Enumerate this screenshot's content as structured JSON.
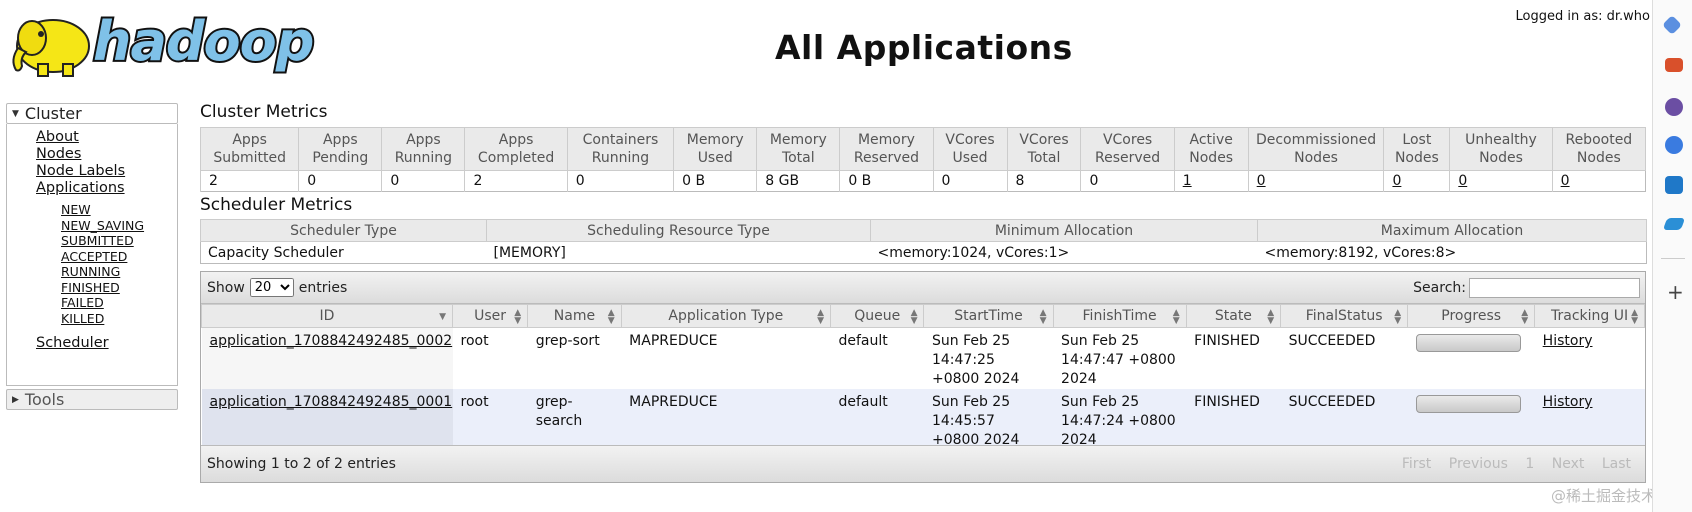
{
  "header": {
    "logo_text": "hadoop",
    "login_text": "Logged in as: dr.who",
    "page_title": "All Applications"
  },
  "sidebar": {
    "cluster_label": "Cluster",
    "links": [
      "About",
      "Nodes",
      "Node Labels",
      "Applications"
    ],
    "app_states": [
      "NEW",
      "NEW_SAVING",
      "SUBMITTED",
      "ACCEPTED",
      "RUNNING",
      "FINISHED",
      "FAILED",
      "KILLED"
    ],
    "scheduler_label": "Scheduler",
    "tools_label": "Tools"
  },
  "cluster_metrics": {
    "title": "Cluster Metrics",
    "headers": [
      "Apps Submitted",
      "Apps Pending",
      "Apps Running",
      "Apps Completed",
      "Containers Running",
      "Memory Used",
      "Memory Total",
      "Memory Reserved",
      "VCores Used",
      "VCores Total",
      "VCores Reserved",
      "Active Nodes",
      "Decommissioned Nodes",
      "Lost Nodes",
      "Unhealthy Nodes",
      "Rebooted Nodes"
    ],
    "values": [
      "2",
      "0",
      "0",
      "2",
      "0",
      "0 B",
      "8 GB",
      "0 B",
      "0",
      "8",
      "0",
      "1",
      "0",
      "0",
      "0",
      "0"
    ]
  },
  "scheduler_metrics": {
    "title": "Scheduler Metrics",
    "headers": [
      "Scheduler Type",
      "Scheduling Resource Type",
      "Minimum Allocation",
      "Maximum Allocation"
    ],
    "values": [
      "Capacity Scheduler",
      "[MEMORY]",
      "<memory:1024, vCores:1>",
      "<memory:8192, vCores:8>"
    ]
  },
  "apps_table": {
    "show_label": "Show",
    "entries_label": "entries",
    "page_size": "20",
    "search_label": "Search:",
    "search_value": "",
    "headers": [
      "ID",
      "User",
      "Name",
      "Application Type",
      "Queue",
      "StartTime",
      "FinishTime",
      "State",
      "FinalStatus",
      "Progress",
      "Tracking UI"
    ],
    "rows": [
      {
        "id": "application_1708842492485_0002",
        "user": "root",
        "name": "grep-sort",
        "type": "MAPREDUCE",
        "queue": "default",
        "start": "Sun Feb 25 14:47:25 +0800 2024",
        "finish": "Sun Feb 25 14:47:47 +0800 2024",
        "state": "FINISHED",
        "final_status": "SUCCEEDED",
        "progress": 1.0,
        "tracking": "History"
      },
      {
        "id": "application_1708842492485_0001",
        "user": "root",
        "name": "grep-search",
        "type": "MAPREDUCE",
        "queue": "default",
        "start": "Sun Feb 25 14:45:57 +0800 2024",
        "finish": "Sun Feb 25 14:47:24 +0800 2024",
        "state": "FINISHED",
        "final_status": "SUCCEEDED",
        "progress": 1.0,
        "tracking": "History"
      }
    ],
    "footer_info": "Showing 1 to 2 of 2 entries",
    "pager": {
      "first": "First",
      "previous": "Previous",
      "page": "1",
      "next": "Next",
      "last": "Last"
    }
  },
  "watermark": "@稀土掘金技术社区",
  "colors": {
    "logo_fill": "#7fc1e8",
    "elephant": "#f5e616",
    "row_alt": "#ebeffa"
  },
  "right_toolbar_icons": [
    "tag-icon",
    "briefcase-icon",
    "person-icon",
    "copilot-icon",
    "outlook-icon",
    "send-icon",
    "add-icon"
  ]
}
